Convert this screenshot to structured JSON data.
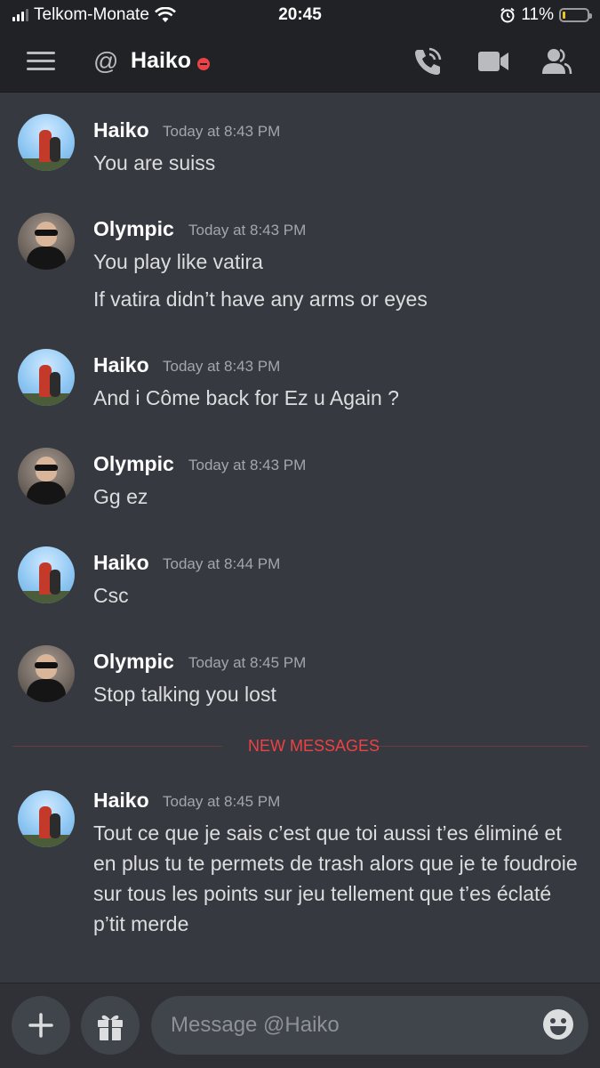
{
  "status_bar": {
    "carrier": "Telkom-Monate",
    "time": "20:45",
    "battery": "11%"
  },
  "header": {
    "at_symbol": "@",
    "title": "Haiko",
    "status": "do-not-disturb",
    "icons": [
      "menu-icon",
      "call-icon",
      "video-icon",
      "members-icon"
    ]
  },
  "messages": [
    {
      "author": "Haiko",
      "timestamp": "Today at 8:43 PM",
      "lines": [
        "You are suiss"
      ]
    },
    {
      "author": "Olympic",
      "timestamp": "Today at 8:43 PM",
      "lines": [
        "You play like vatira",
        "If vatira didn’t have any arms or eyes"
      ]
    },
    {
      "author": "Haiko",
      "timestamp": "Today at 8:43 PM",
      "lines": [
        "And i Côme back for Ez u Again ?"
      ]
    },
    {
      "author": "Olympic",
      "timestamp": "Today at 8:43 PM",
      "lines": [
        "Gg ez"
      ]
    },
    {
      "author": "Haiko",
      "timestamp": "Today at 8:44 PM",
      "lines": [
        "Csc"
      ]
    },
    {
      "author": "Olympic",
      "timestamp": "Today at 8:45 PM",
      "lines": [
        "Stop talking you lost"
      ]
    },
    {
      "author": "Haiko",
      "timestamp": "Today at 8:45 PM",
      "lines": [
        "Tout ce que je sais c’est que toi aussi t’es éliminé et en plus tu te permets de trash alors que je te foudroie sur tous les points sur jeu tellement que t’es éclaté p’tit merde"
      ]
    }
  ],
  "divider": {
    "label": "NEW MESSAGES"
  },
  "composer": {
    "placeholder": "Message @Haiko"
  },
  "colors": {
    "background": "#36393f",
    "header": "#202225",
    "accent_red": "#ed4245",
    "input": "#40444b"
  }
}
